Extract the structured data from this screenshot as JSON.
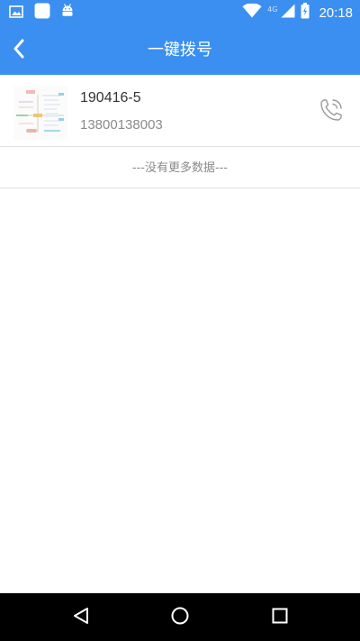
{
  "status_bar": {
    "time": "20:18",
    "network": "4G",
    "icons": [
      "image-notification-icon",
      "app-notification-icon",
      "android-notification-icon",
      "wifi-icon",
      "signal-icon",
      "battery-icon"
    ]
  },
  "header": {
    "title": "一键拨号",
    "back_icon": "back-chevron-icon"
  },
  "contacts": [
    {
      "name": "190416-5",
      "phone": "13800138003",
      "thumbnail_icon": "mindmap-thumbnail",
      "call_icon": "phone-call-icon"
    }
  ],
  "list_footer": {
    "text": "---没有更多数据---"
  },
  "system_nav": {
    "icons": [
      "nav-back-icon",
      "nav-home-icon",
      "nav-recents-icon"
    ]
  },
  "colors": {
    "primary": "#3a8ff0",
    "text_primary": "#333333",
    "text_secondary": "#8a8a8a",
    "divider": "#e2e2e2"
  }
}
